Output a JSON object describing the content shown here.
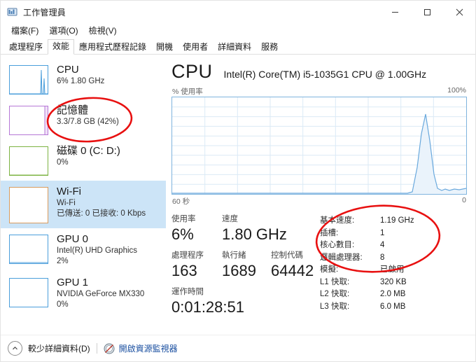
{
  "window": {
    "title": "工作管理員",
    "icon": "task-manager-icon",
    "minimize": "−",
    "maximize": "□",
    "close": "✕"
  },
  "menu": {
    "items": [
      {
        "label": "檔案(F)",
        "name": "menu-file"
      },
      {
        "label": "選項(O)",
        "name": "menu-options"
      },
      {
        "label": "檢視(V)",
        "name": "menu-view"
      }
    ]
  },
  "tabs": [
    {
      "label": "處理程序",
      "active": false
    },
    {
      "label": "效能",
      "active": true
    },
    {
      "label": "應用程式歷程記錄",
      "active": false
    },
    {
      "label": "開機",
      "active": false
    },
    {
      "label": "使用者",
      "active": false
    },
    {
      "label": "詳細資料",
      "active": false
    },
    {
      "label": "服務",
      "active": false
    }
  ],
  "sidebar": {
    "items": [
      {
        "title": "CPU",
        "sub1": "6%  1.80 GHz",
        "sub2": "",
        "color": "#4a9edb",
        "selected": false,
        "name": "sidebar-item-cpu"
      },
      {
        "title": "記憶體",
        "sub1": "3.3/7.8 GB (42%)",
        "sub2": "",
        "color": "#b678d6",
        "selected": false,
        "name": "sidebar-item-memory"
      },
      {
        "title": "磁碟 0 (C: D:)",
        "sub1": "0%",
        "sub2": "",
        "color": "#7cb342",
        "selected": false,
        "name": "sidebar-item-disk0"
      },
      {
        "title": "Wi-Fi",
        "sub1": "Wi-Fi",
        "sub2": "已傳送: 0 已接收: 0 Kbps",
        "color": "#d89b5e",
        "selected": true,
        "name": "sidebar-item-wifi"
      },
      {
        "title": "GPU 0",
        "sub1": "Intel(R) UHD Graphics",
        "sub2": "2%",
        "color": "#4a9edb",
        "selected": false,
        "name": "sidebar-item-gpu0"
      },
      {
        "title": "GPU 1",
        "sub1": "NVIDIA GeForce MX330",
        "sub2": "0%",
        "color": "#4a9edb",
        "selected": false,
        "name": "sidebar-item-gpu1"
      }
    ]
  },
  "main": {
    "title": "CPU",
    "subtitle": "Intel(R) Core(TM) i5-1035G1 CPU @ 1.00GHz",
    "graph": {
      "y_label": "% 使用率",
      "y_max": "100%",
      "x_left": "60 秒",
      "x_right": "0"
    },
    "stats_left": [
      {
        "label": "使用率",
        "value": "6%",
        "name": "utilization"
      },
      {
        "label": "速度",
        "value": "1.80 GHz",
        "name": "speed"
      },
      {
        "label": "處理程序",
        "value": "163",
        "name": "processes"
      },
      {
        "label": "執行緒",
        "value": "1689",
        "name": "threads"
      },
      {
        "label": "控制代碼",
        "value": "64442",
        "name": "handles"
      },
      {
        "label": "運作時間",
        "value": "0:01:28:51",
        "name": "uptime"
      }
    ],
    "specs": [
      {
        "key": "基本速度:",
        "value": "1.19 GHz",
        "name": "base-speed"
      },
      {
        "key": "插槽:",
        "value": "1",
        "name": "sockets"
      },
      {
        "key": "核心數目:",
        "value": "4",
        "name": "cores"
      },
      {
        "key": "邏輯處理器:",
        "value": "8",
        "name": "logical-processors"
      },
      {
        "key": "模擬:",
        "value": "已啟用",
        "name": "virtualization"
      },
      {
        "key": "L1 快取:",
        "value": "320 KB",
        "name": "l1-cache"
      },
      {
        "key": "L2 快取:",
        "value": "2.0 MB",
        "name": "l2-cache"
      },
      {
        "key": "L3 快取:",
        "value": "6.0 MB",
        "name": "l3-cache"
      }
    ]
  },
  "footer": {
    "fewer_details": "較少詳細資料(D)",
    "resource_monitor": "開啟資源監視器"
  },
  "annotations": {
    "color": "#e81010",
    "items": [
      {
        "name": "annotation-ellipse-memory",
        "target": "記憶體 3.3/7.8 GB (42%)"
      },
      {
        "name": "annotation-ellipse-cpu-specs",
        "target": "基本速度 / 插槽 / 核心數目 / 邏輯處理器"
      }
    ]
  },
  "chart_data": {
    "type": "area",
    "title": "CPU 使用率",
    "ylabel": "% 使用率",
    "xlabel": "60 秒",
    "ylim": [
      0,
      100
    ],
    "x_axis_labels": [
      "60 秒",
      "0"
    ],
    "grid": true,
    "series": [
      {
        "name": "% 使用率",
        "values": [
          0,
          0,
          0,
          0,
          0,
          0,
          0,
          0,
          0,
          0,
          0,
          0,
          0,
          0,
          0,
          0,
          0,
          0,
          0,
          0,
          0,
          0,
          0,
          0,
          0,
          0,
          0,
          0,
          0,
          0,
          0,
          0,
          0,
          0,
          0,
          0,
          0,
          0,
          0,
          0,
          0,
          0,
          0,
          0,
          0,
          0,
          0,
          0,
          1,
          2,
          30,
          62,
          80,
          55,
          25,
          6,
          3,
          5,
          4,
          6
        ]
      }
    ],
    "current_value": 6,
    "current_speed": "1.80 GHz"
  }
}
